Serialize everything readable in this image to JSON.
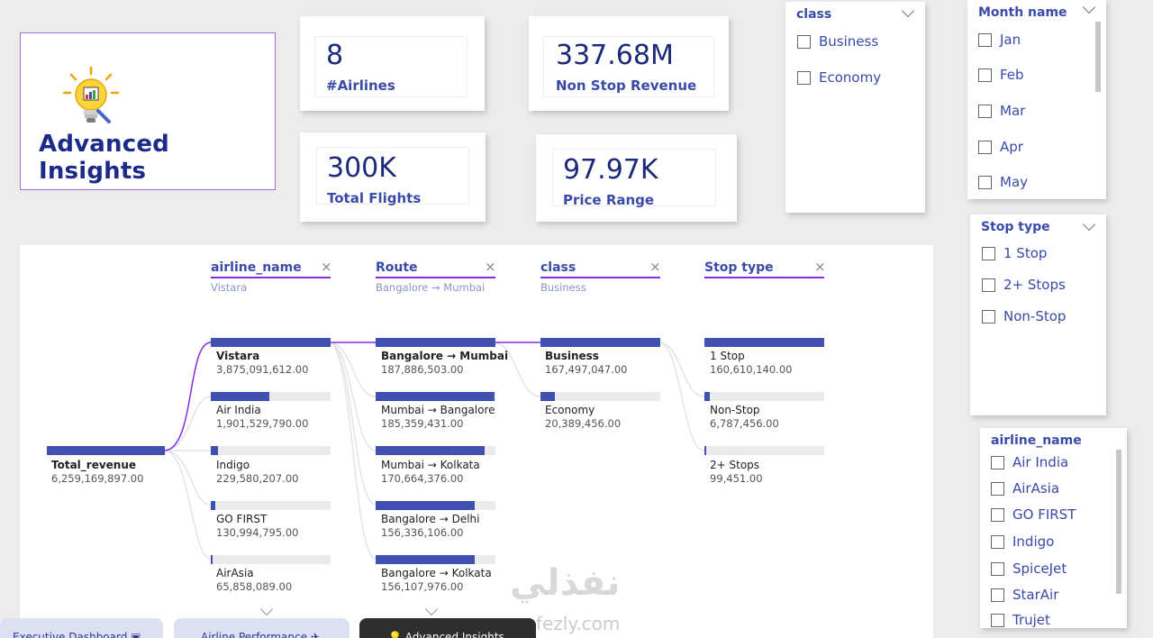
{
  "title_card": {
    "title": "Advanced Insights",
    "icon": "lightbulb-chart-icon"
  },
  "kpis": [
    {
      "value": "8",
      "label": "#Airlines"
    },
    {
      "value": "337.68M",
      "label": "Non Stop Revenue"
    },
    {
      "value": "300K",
      "label": "Total  Flights"
    },
    {
      "value": "97.97K",
      "label": "Price Range"
    }
  ],
  "slicers": {
    "class": {
      "title": "class",
      "options": [
        "Business",
        "Economy"
      ]
    },
    "month": {
      "title": "Month name",
      "options": [
        "Jan",
        "Feb",
        "Mar",
        "Apr",
        "May"
      ]
    },
    "stop": {
      "title": "Stop type",
      "options": [
        "1 Stop",
        "2+ Stops",
        "Non-Stop"
      ]
    },
    "airline": {
      "title": "airline_name",
      "options": [
        "Air India",
        "AirAsia",
        "GO FIRST",
        "Indigo",
        "SpiceJet",
        "StarAir",
        "Trujet"
      ]
    }
  },
  "decomp": {
    "root": {
      "name": "Total_revenue",
      "value": "6,259,169,897.00"
    },
    "levels": [
      {
        "head": "airline_name",
        "filter": "Vistara",
        "nodes": [
          {
            "name": "Vistara",
            "value": "3,875,091,612.00",
            "frac": 1.0,
            "selected": true
          },
          {
            "name": "Air India",
            "value": "1,901,529,790.00",
            "frac": 0.49
          },
          {
            "name": "Indigo",
            "value": "229,580,207.00",
            "frac": 0.06
          },
          {
            "name": "GO FIRST",
            "value": "130,994,795.00",
            "frac": 0.034
          },
          {
            "name": "AirAsia",
            "value": "65,858,089.00",
            "frac": 0.017
          }
        ]
      },
      {
        "head": "Route",
        "filter": "Bangalore → Mumbai",
        "nodes": [
          {
            "name": "Bangalore → Mumbai",
            "value": "187,886,503.00",
            "frac": 1.0,
            "selected": true
          },
          {
            "name": "Mumbai → Bangalore",
            "value": "185,359,431.00",
            "frac": 0.99
          },
          {
            "name": "Mumbai → Kolkata",
            "value": "170,664,376.00",
            "frac": 0.91
          },
          {
            "name": "Bangalore → Delhi",
            "value": "156,336,106.00",
            "frac": 0.83
          },
          {
            "name": "Bangalore → Kolkata",
            "value": "156,107,976.00",
            "frac": 0.83
          }
        ]
      },
      {
        "head": "class",
        "filter": "Business",
        "nodes": [
          {
            "name": "Business",
            "value": "167,497,047.00",
            "frac": 1.0,
            "selected": true
          },
          {
            "name": "Economy",
            "value": "20,389,456.00",
            "frac": 0.12
          }
        ]
      },
      {
        "head": "Stop type",
        "filter": "",
        "nodes": [
          {
            "name": "1 Stop",
            "value": "160,610,140.00",
            "frac": 1.0
          },
          {
            "name": "Non-Stop",
            "value": "6,787,456.00",
            "frac": 0.042
          },
          {
            "name": "2+ Stops",
            "value": "99,451.00",
            "frac": 0.001
          }
        ]
      }
    ]
  },
  "nav": [
    {
      "label": "Executive Dashboard",
      "icon": "dashboard-icon"
    },
    {
      "label": "Airline Performance",
      "icon": "plane-icon"
    },
    {
      "label": "Advanced Insights",
      "icon": "lightbulb-icon"
    }
  ],
  "watermark": {
    "arabic": "نفذلي",
    "latin": "nafezly.com"
  },
  "colors": {
    "bar": "#3f4fb2",
    "accent": "#8a2be2",
    "text": "#1c2a7a"
  }
}
